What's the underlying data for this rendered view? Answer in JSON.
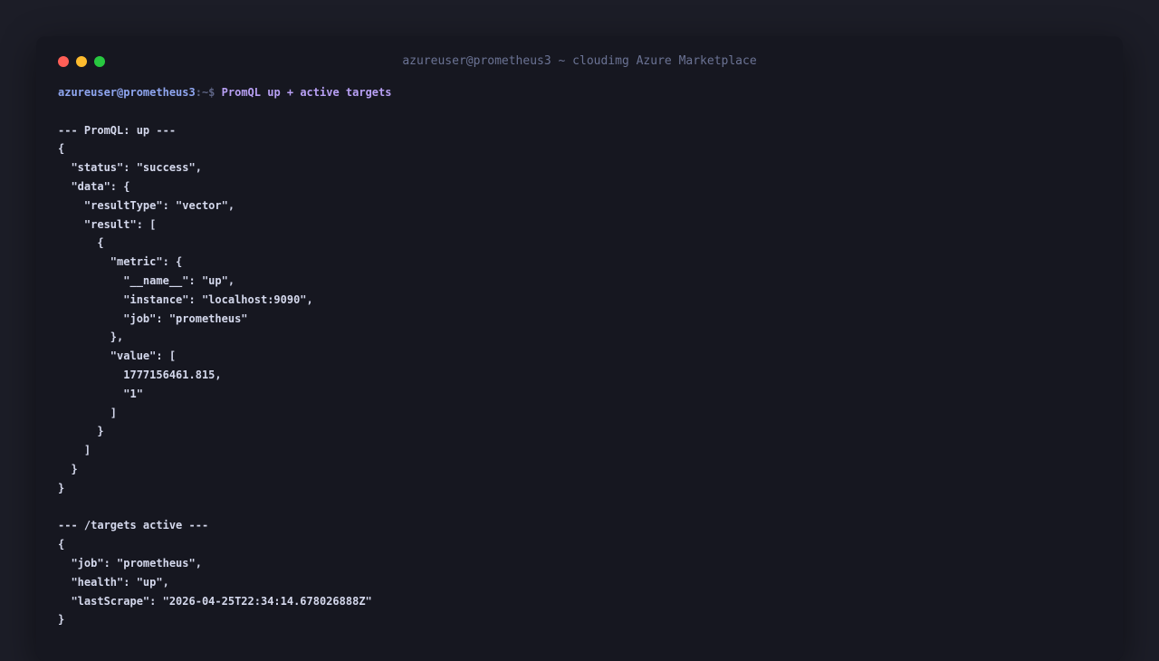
{
  "window": {
    "title": "azureuser@prometheus3 ~ cloudimg Azure Marketplace",
    "controls": [
      "close",
      "minimize",
      "maximize"
    ]
  },
  "prompt": {
    "user_host": "azureuser@prometheus3",
    "path_symbol": ":~$",
    "command": "PromQL up + active targets"
  },
  "output_lines": [
    "",
    "--- PromQL: up ---",
    "{",
    "  \"status\": \"success\",",
    "  \"data\": {",
    "    \"resultType\": \"vector\",",
    "    \"result\": [",
    "      {",
    "        \"metric\": {",
    "          \"__name__\": \"up\",",
    "          \"instance\": \"localhost:9090\",",
    "          \"job\": \"prometheus\"",
    "        },",
    "        \"value\": [",
    "          1777156461.815,",
    "          \"1\"",
    "        ]",
    "      }",
    "    ]",
    "  }",
    "}",
    "",
    "--- /targets active ---",
    "{",
    "  \"job\": \"prometheus\",",
    "  \"health\": \"up\",",
    "  \"lastScrape\": \"2026-04-25T22:34:14.678026888Z\"",
    "}"
  ],
  "colors": {
    "background": "#1c1d27",
    "window": "#161720",
    "text": "#d4d8ec",
    "prompt_user": "#8fa6f0",
    "command": "#b8a0f4",
    "close": "#ff5f57",
    "minimize": "#febc2e",
    "maximize": "#28c840"
  }
}
